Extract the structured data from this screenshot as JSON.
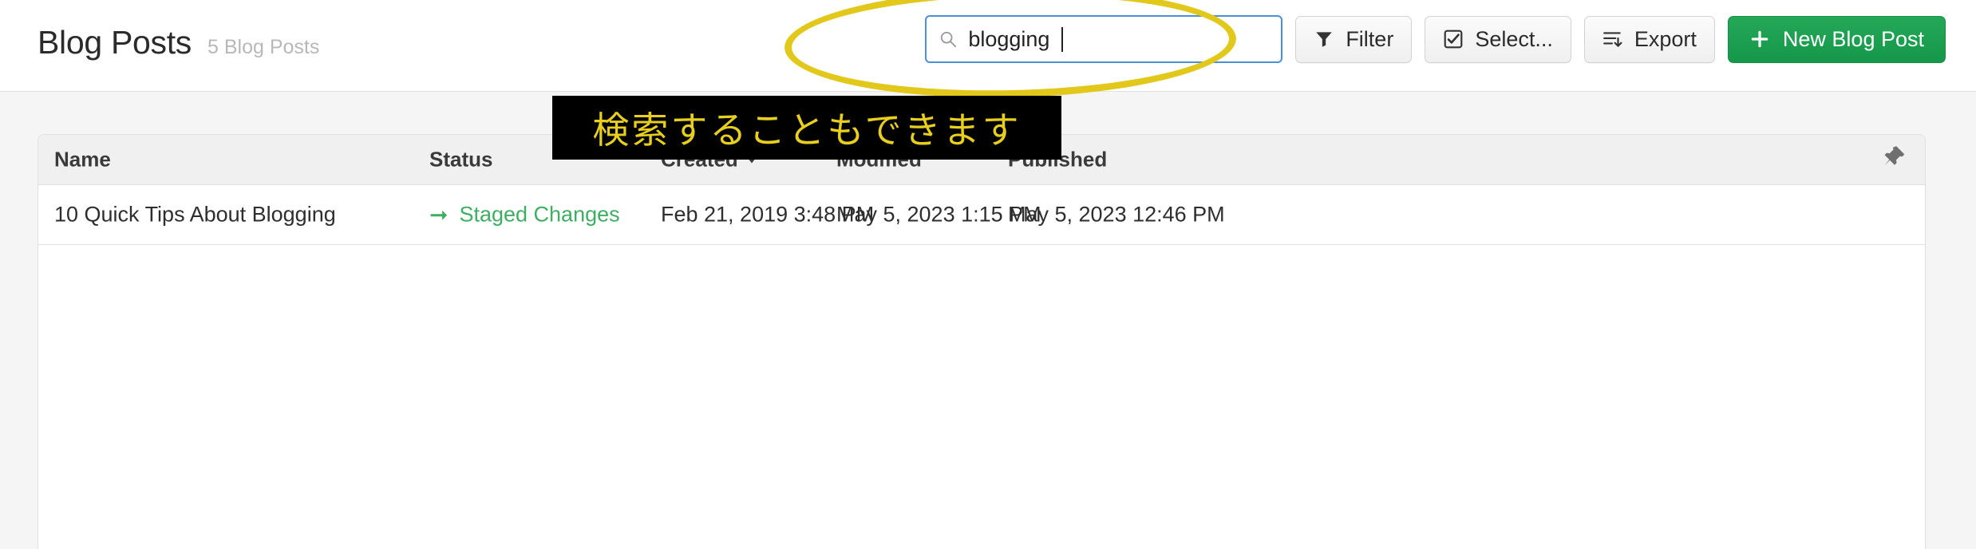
{
  "header": {
    "title": "Blog Posts",
    "subtitle": "5 Blog Posts"
  },
  "search": {
    "icon": "search-icon",
    "value": "blogging",
    "placeholder": "Search"
  },
  "toolbar": {
    "filter_label": "Filter",
    "select_label": "Select...",
    "export_label": "Export",
    "new_label": "New Blog Post",
    "new_icon": "plus-icon",
    "filter_icon": "funnel-icon",
    "select_icon": "checkbox-icon",
    "export_icon": "list-down-icon",
    "primary_color": "#1c9e4f"
  },
  "table": {
    "columns": [
      "Name",
      "Status",
      "Created",
      "Modified",
      "Published"
    ],
    "sorted_column": "Created",
    "sort_direction": "desc",
    "pin_icon": "pin-icon",
    "rows": [
      {
        "name": "10 Quick Tips About Blogging",
        "status": "Staged Changes",
        "status_icon": "arrow-right-icon",
        "status_color": "#3fae62",
        "created": "Feb 21, 2019 3:48 PM",
        "modified": "May 5, 2023 1:15 PM",
        "published": "May 5, 2023 12:46 PM"
      }
    ]
  },
  "annotations": {
    "caption": "検索することもできます",
    "caption_color": "#e8cf1e",
    "highlight_color": "#e3c81c",
    "highlight_shape": "ellipse-around-search"
  }
}
